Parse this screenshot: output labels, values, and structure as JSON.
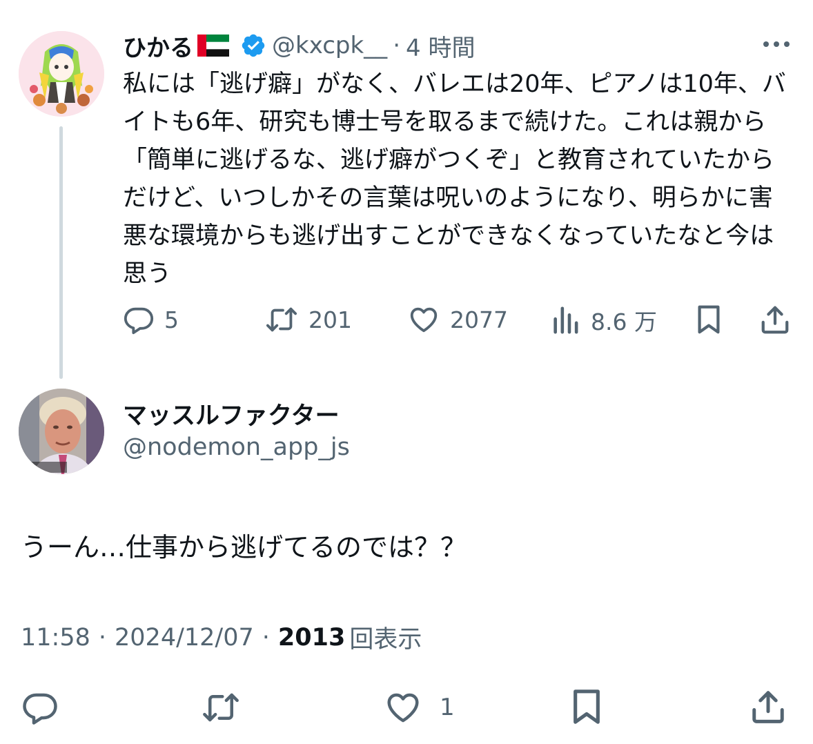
{
  "tweet1": {
    "display_name": "ひかる",
    "handle": "@kxcpk__",
    "time_ago": "4 時間",
    "separator": "·",
    "text": "私には「逃げ癖」がなく、バレエは20年、ピアノは10年、バイトも6年、研究も博士号を取るまで続けた。これは親から「簡単に逃げるな、逃げ癖がつくぞ」と教育されていたからだけど、いつしかその言葉は呪いのようになり、明らかに害悪な環境からも逃げ出すことができなくなっていたなと今は思う",
    "replies": "5",
    "retweets": "201",
    "likes": "2077",
    "views": "8.6 万"
  },
  "tweet2": {
    "display_name": "マッスルファクター",
    "handle": "@nodemon_app_js",
    "text": "うーん…仕事から逃げてるのでは？？",
    "time": "11:58",
    "date": "2024/12/07",
    "separator": "·",
    "view_count": "2013",
    "view_label": "回表示",
    "likes": "1"
  },
  "colors": {
    "text_primary": "#0f1419",
    "text_secondary": "#536471",
    "verified_blue": "#1d9bf0",
    "thread_line": "#cfd9de"
  },
  "icons": [
    "more-icon",
    "verified-badge-icon",
    "uae-flag-icon",
    "reply-icon",
    "retweet-icon",
    "like-icon",
    "views-icon",
    "bookmark-icon",
    "share-icon"
  ]
}
